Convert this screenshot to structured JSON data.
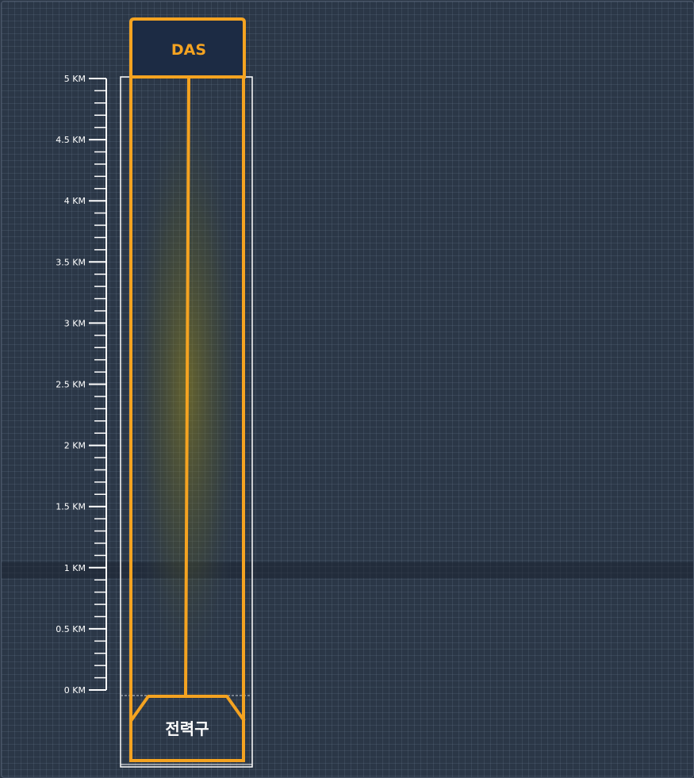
{
  "header": {
    "label": "DAS"
  },
  "footer": {
    "label": "전력구"
  },
  "scale": {
    "labels": [
      {
        "text": "5 KM",
        "km": 5
      },
      {
        "text": "4.5 KM",
        "km": 4.5
      },
      {
        "text": "4 KM",
        "km": 4
      },
      {
        "text": "3.5 KM",
        "km": 3.5
      },
      {
        "text": "3 KM",
        "km": 3
      },
      {
        "text": "2.5 KM",
        "km": 2.5
      },
      {
        "text": "2 KM",
        "km": 2
      },
      {
        "text": "1.5 KM",
        "km": 1.5
      },
      {
        "text": "1 KM",
        "km": 1
      },
      {
        "text": "0.5 KM",
        "km": 0.5
      },
      {
        "text": "0 KM",
        "km": 0
      }
    ],
    "max_km": 5,
    "minor_divisions": 10
  },
  "colors": {
    "background": "#2b3747",
    "accent": "#f4a321",
    "header_fill": "#1c2b44",
    "scale": "#ffffff"
  }
}
